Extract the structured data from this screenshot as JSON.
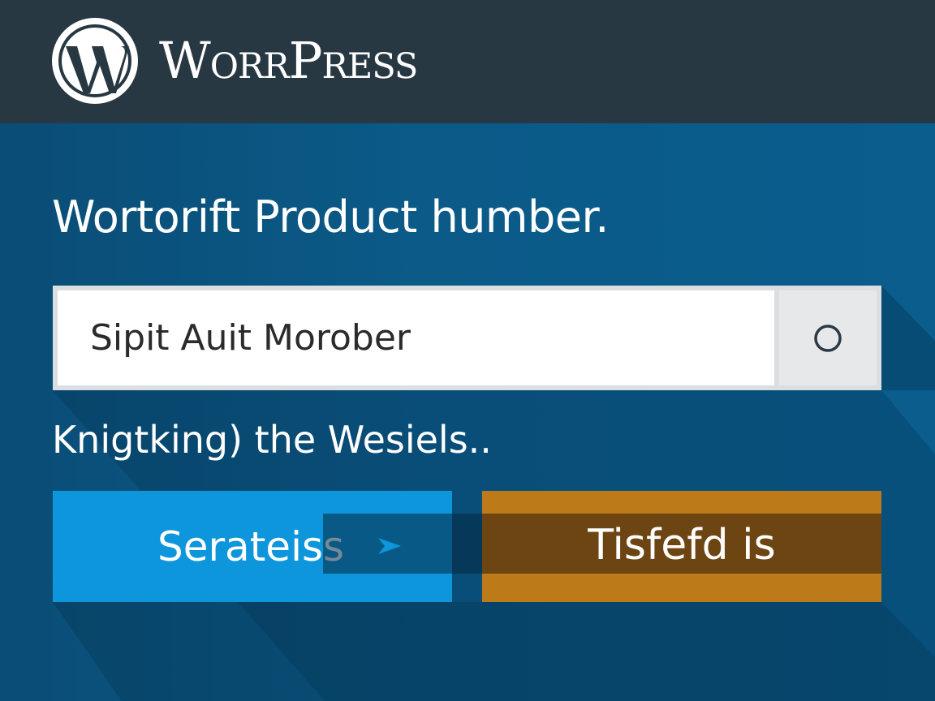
{
  "header": {
    "brand_name": "WorrPress",
    "logo_icon": "wordpress-logo-icon"
  },
  "main": {
    "heading": "Wortorift Product humber.",
    "search": {
      "value": "Sipit Auit Morober",
      "button_icon": "circle-search-icon"
    },
    "status_text": "Knigtking) the Wesiels..",
    "buttons": {
      "primary_label": "Serateiss",
      "connector_icon": "arrow-right-icon",
      "secondary_label": "Tisfefd is"
    }
  },
  "colors": {
    "header_bg": "#283843",
    "page_bg": "#0b5a88",
    "primary_button": "#0e96dc",
    "secondary_button": "#bd7a18",
    "secondary_band": "#6d4512"
  }
}
